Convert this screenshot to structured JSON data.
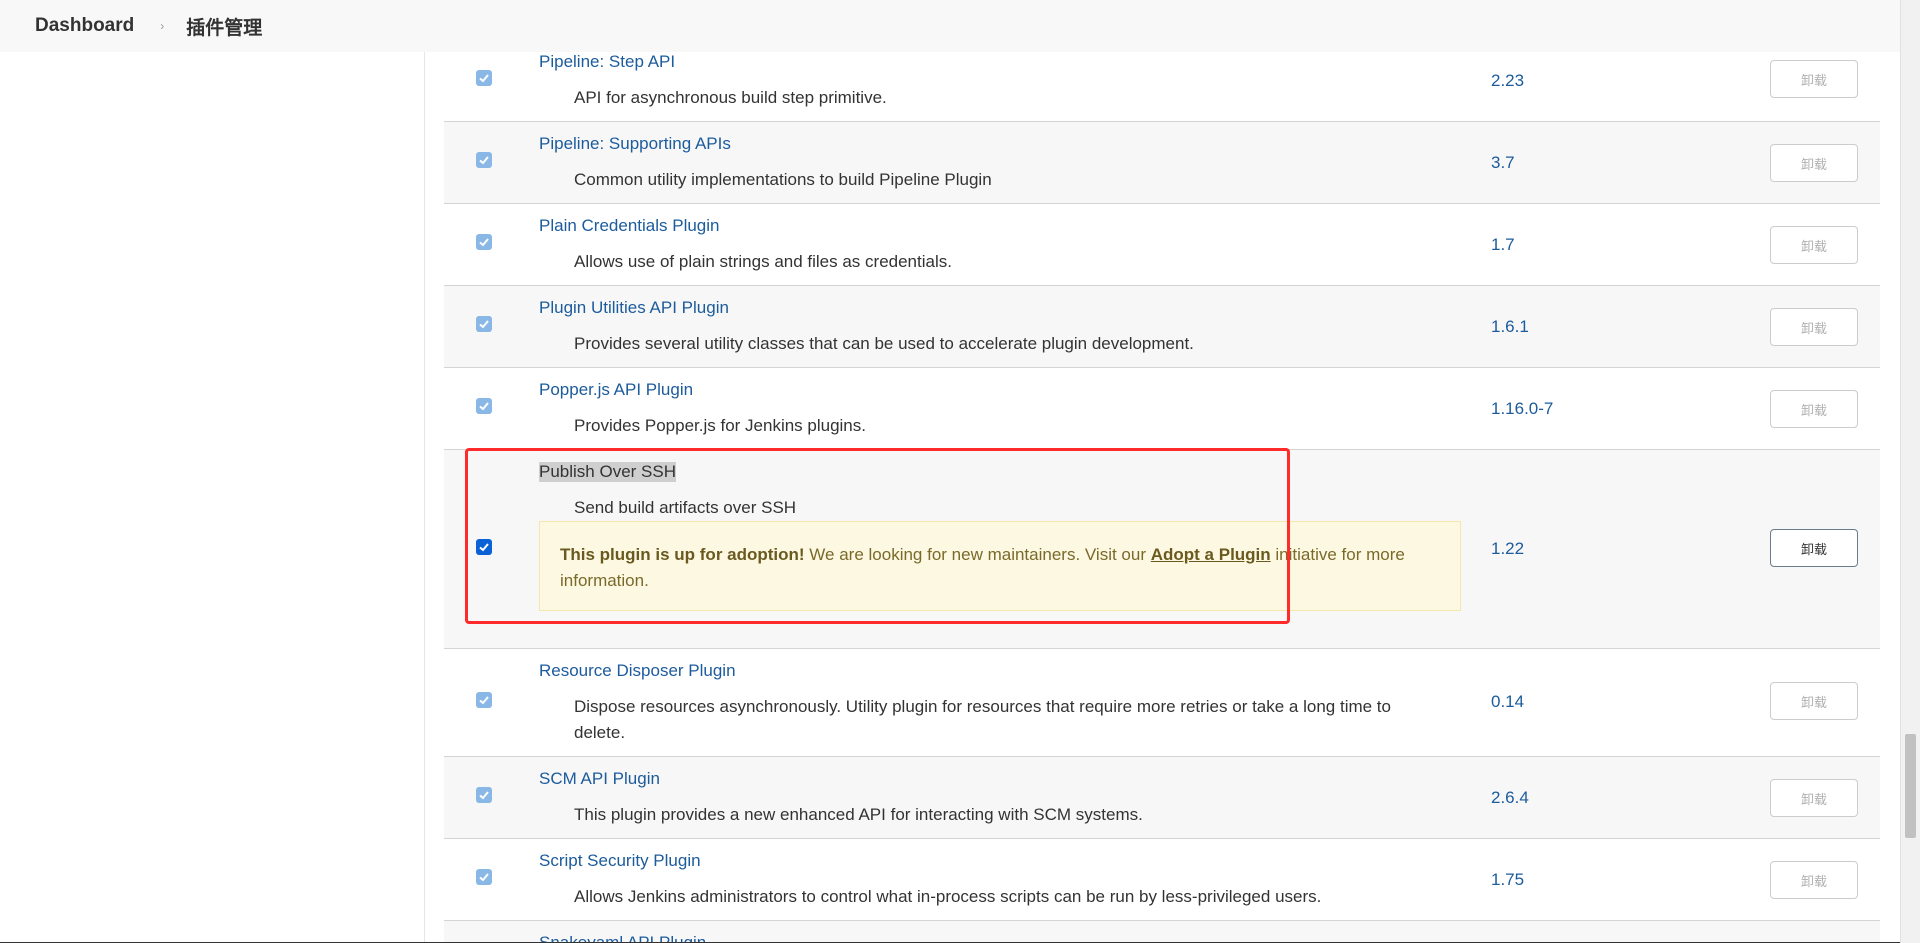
{
  "breadcrumb": {
    "dashboard": "Dashboard",
    "separator": "›",
    "current": "插件管理"
  },
  "uninstall_label": "卸载",
  "plugins": [
    {
      "name": "Pipeline: Step API",
      "description": "API for asynchronous build step primitive.",
      "version": "2.23",
      "checked": true
    },
    {
      "name": "Pipeline: Supporting APIs",
      "description": "Common utility implementations to build Pipeline Plugin",
      "version": "3.7",
      "checked": true
    },
    {
      "name": "Plain Credentials Plugin",
      "description": "Allows use of plain strings and files as credentials.",
      "version": "1.7",
      "checked": true
    },
    {
      "name": "Plugin Utilities API Plugin",
      "description": "Provides several utility classes that can be used to accelerate plugin development.",
      "version": "1.6.1",
      "checked": true
    },
    {
      "name": "Popper.js API Plugin",
      "description": "Provides Popper.js for Jenkins plugins.",
      "version": "1.16.0-7",
      "checked": true
    },
    {
      "name": "Publish Over SSH",
      "description": "Send build artifacts over SSH",
      "version": "1.22",
      "checked": true,
      "adoption": {
        "strong": "This plugin is up for adoption!",
        "before_link": " We are looking for new maintainers. Visit our ",
        "link": "Adopt a Plugin",
        "after_link": " initiative for more information."
      }
    },
    {
      "name": "Resource Disposer Plugin",
      "description": "Dispose resources asynchronously. Utility plugin for resources that require more retries or take a long time to delete.",
      "version": "0.14",
      "checked": true
    },
    {
      "name": "SCM API Plugin",
      "description": "This plugin provides a new enhanced API for interacting with SCM systems.",
      "version": "2.6.4",
      "checked": true
    },
    {
      "name": "Script Security Plugin",
      "description": "Allows Jenkins administrators to control what in-process scripts can be run by less-privileged users.",
      "version": "1.75",
      "checked": true
    },
    {
      "name": "Snakeyaml API Plugin",
      "description": "",
      "version": "",
      "checked": true
    }
  ],
  "colors": {
    "link": "#1c5b9c",
    "highlight_outline": "#ff2a2a",
    "adoption_background": "#fdf8e1"
  }
}
